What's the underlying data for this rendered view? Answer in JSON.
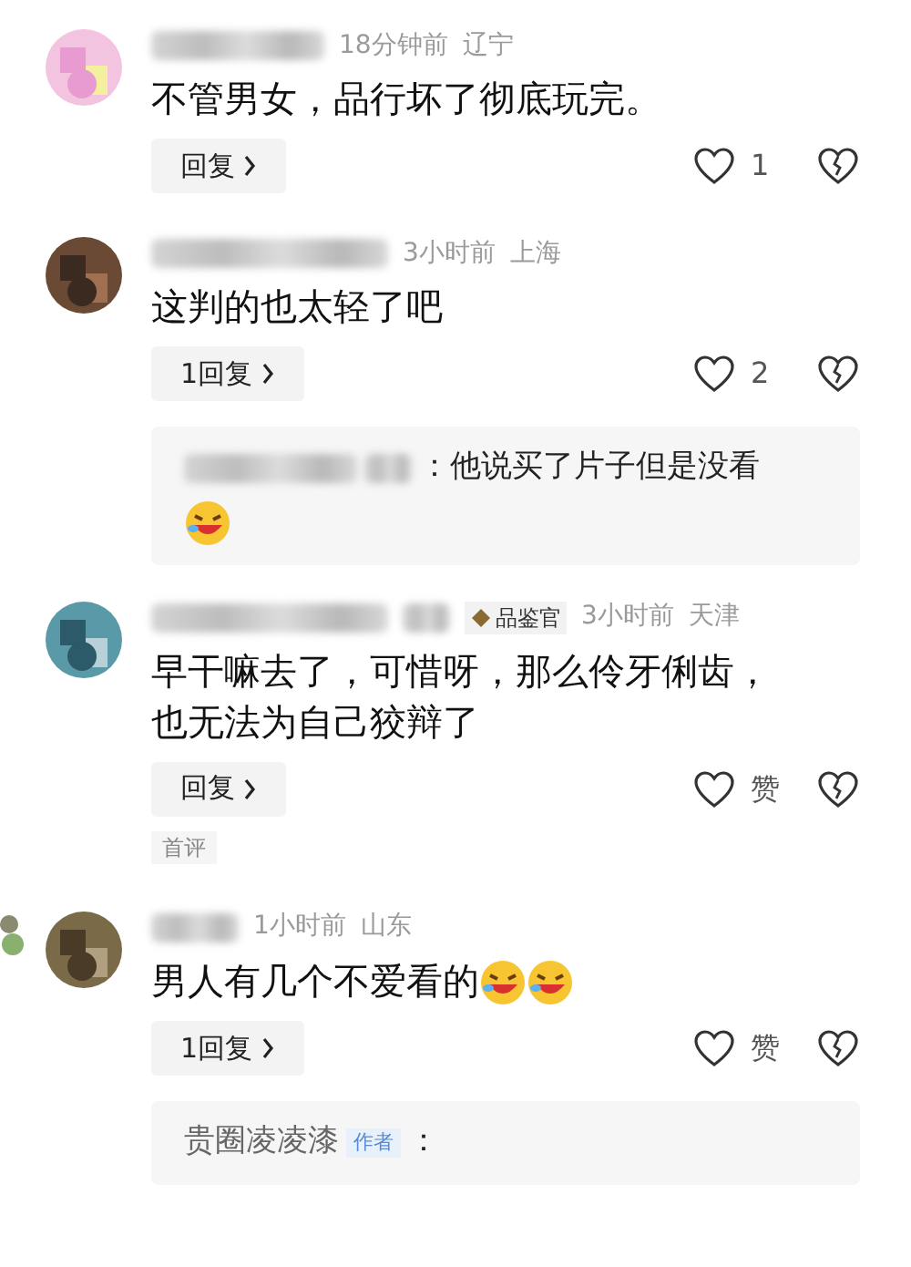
{
  "comments": [
    {
      "time": "18分钟前",
      "location": "辽宁",
      "text": "不管男女，品行坏了彻底玩完。",
      "reply_button": "回复",
      "likes": "1"
    },
    {
      "time": "3小时前",
      "location": "上海",
      "text": "这判的也太轻了吧",
      "reply_button": "1回复",
      "likes": "2",
      "reply_preview": {
        "text": "：他说买了片子但是没看",
        "emojis": [
          {
            "kind": "laughing"
          }
        ]
      }
    },
    {
      "time": "3小时前",
      "location": "天津",
      "badge": "品鉴官",
      "text": "早干嘛去了，可惜呀，那么伶牙俐齿，也无法为自己狡辩了",
      "reply_button": "回复",
      "likes": "赞",
      "label": "首评"
    },
    {
      "time": "1小时前",
      "location": "山东",
      "text": "男人有几个不爱看的",
      "emojis": [
        {
          "kind": "laughing"
        },
        {
          "kind": "laughing"
        }
      ],
      "reply_button": "1回复",
      "likes": "赞",
      "reply_preview": {
        "author": "贵圈凌凌漆",
        "tag": "作者",
        "text": "："
      }
    }
  ]
}
